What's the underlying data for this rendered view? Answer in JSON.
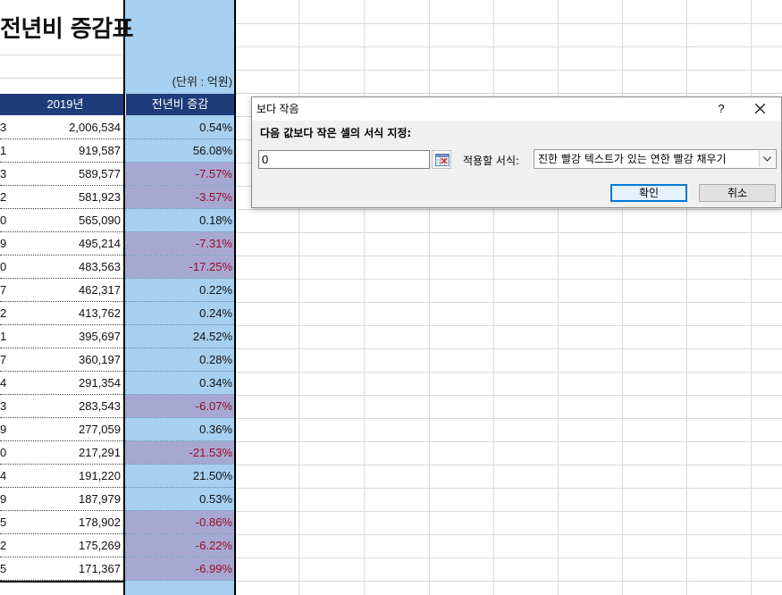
{
  "sheet": {
    "title": "전년비 증감표",
    "unit": "(단위 : 억원)",
    "columns": {
      "year": "2019년",
      "change": "전년비 증감"
    },
    "rows": [
      {
        "stub": "3",
        "value": "2,006,534",
        "change": "0.54%",
        "neg": false
      },
      {
        "stub": "1",
        "value": "919,587",
        "change": "56.08%",
        "neg": false
      },
      {
        "stub": "3",
        "value": "589,577",
        "change": "-7.57%",
        "neg": true
      },
      {
        "stub": "2",
        "value": "581,923",
        "change": "-3.57%",
        "neg": true
      },
      {
        "stub": "0",
        "value": "565,090",
        "change": "0.18%",
        "neg": false
      },
      {
        "stub": "9",
        "value": "495,214",
        "change": "-7.31%",
        "neg": true
      },
      {
        "stub": "0",
        "value": "483,563",
        "change": "-17.25%",
        "neg": true
      },
      {
        "stub": "7",
        "value": "462,317",
        "change": "0.22%",
        "neg": false
      },
      {
        "stub": "2",
        "value": "413,762",
        "change": "0.24%",
        "neg": false
      },
      {
        "stub": "1",
        "value": "395,697",
        "change": "24.52%",
        "neg": false
      },
      {
        "stub": "7",
        "value": "360,197",
        "change": "0.28%",
        "neg": false
      },
      {
        "stub": "4",
        "value": "291,354",
        "change": "0.34%",
        "neg": false
      },
      {
        "stub": "3",
        "value": "283,543",
        "change": "-6.07%",
        "neg": true
      },
      {
        "stub": "9",
        "value": "277,059",
        "change": "0.36%",
        "neg": false
      },
      {
        "stub": "0",
        "value": "217,291",
        "change": "-21.53%",
        "neg": true
      },
      {
        "stub": "4",
        "value": "191,220",
        "change": "21.50%",
        "neg": false
      },
      {
        "stub": "9",
        "value": "187,979",
        "change": "0.53%",
        "neg": false
      },
      {
        "stub": "5",
        "value": "178,902",
        "change": "-0.86%",
        "neg": true
      },
      {
        "stub": "2",
        "value": "175,269",
        "change": "-6.22%",
        "neg": true
      },
      {
        "stub": "5",
        "value": "171,367",
        "change": "-6.99%",
        "neg": true
      }
    ]
  },
  "dialog": {
    "title": "보다 작음",
    "help": "?",
    "prompt": "다음 값보다 작은 셀의 서식 지정:",
    "input_value": "0",
    "format_label": "적용할 서식:",
    "format_selected": "진한 빨강 텍스트가 있는 연한 빨강 채우기",
    "ok": "확인",
    "cancel": "취소"
  },
  "colors": {
    "header_bg": "#1f3c7a",
    "selection_bg": "#a6cff0",
    "negative_fill": "#a7a8d2",
    "negative_text": "#9c0b23",
    "ok_border": "#0078d7"
  }
}
